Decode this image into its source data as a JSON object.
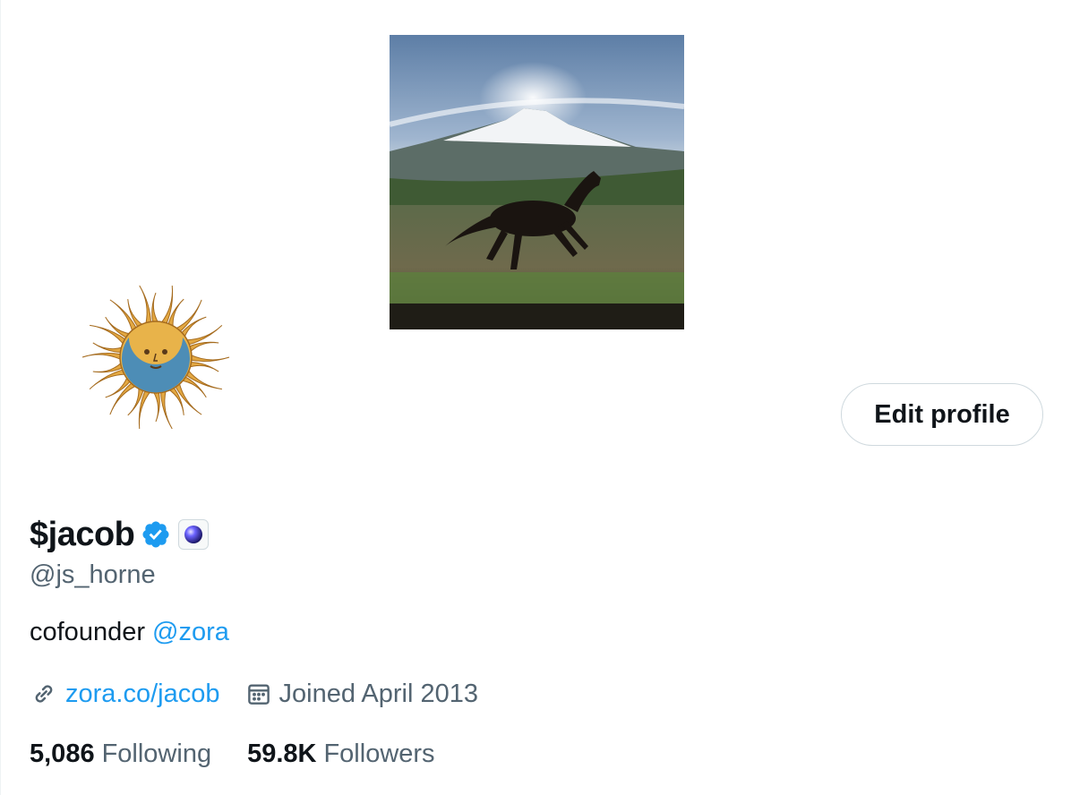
{
  "profile": {
    "display_name": "$jacob",
    "handle": "@js_horne",
    "bio_text": "cofounder ",
    "bio_mention": "@zora",
    "website": "zora.co/jacob",
    "joined": "Joined April 2013"
  },
  "actions": {
    "edit_profile_label": "Edit profile"
  },
  "stats": {
    "following_count": "5,086",
    "following_label": "Following",
    "followers_count": "59.8K",
    "followers_label": "Followers"
  },
  "icons": {
    "verified": "verified-badge-icon",
    "affiliate": "affiliate-badge-icon",
    "link": "link-icon",
    "calendar": "calendar-icon"
  },
  "colors": {
    "accent": "#1d9bf0",
    "secondary_text": "#536471",
    "primary_text": "#0f1419",
    "border": "#cfd9de"
  }
}
